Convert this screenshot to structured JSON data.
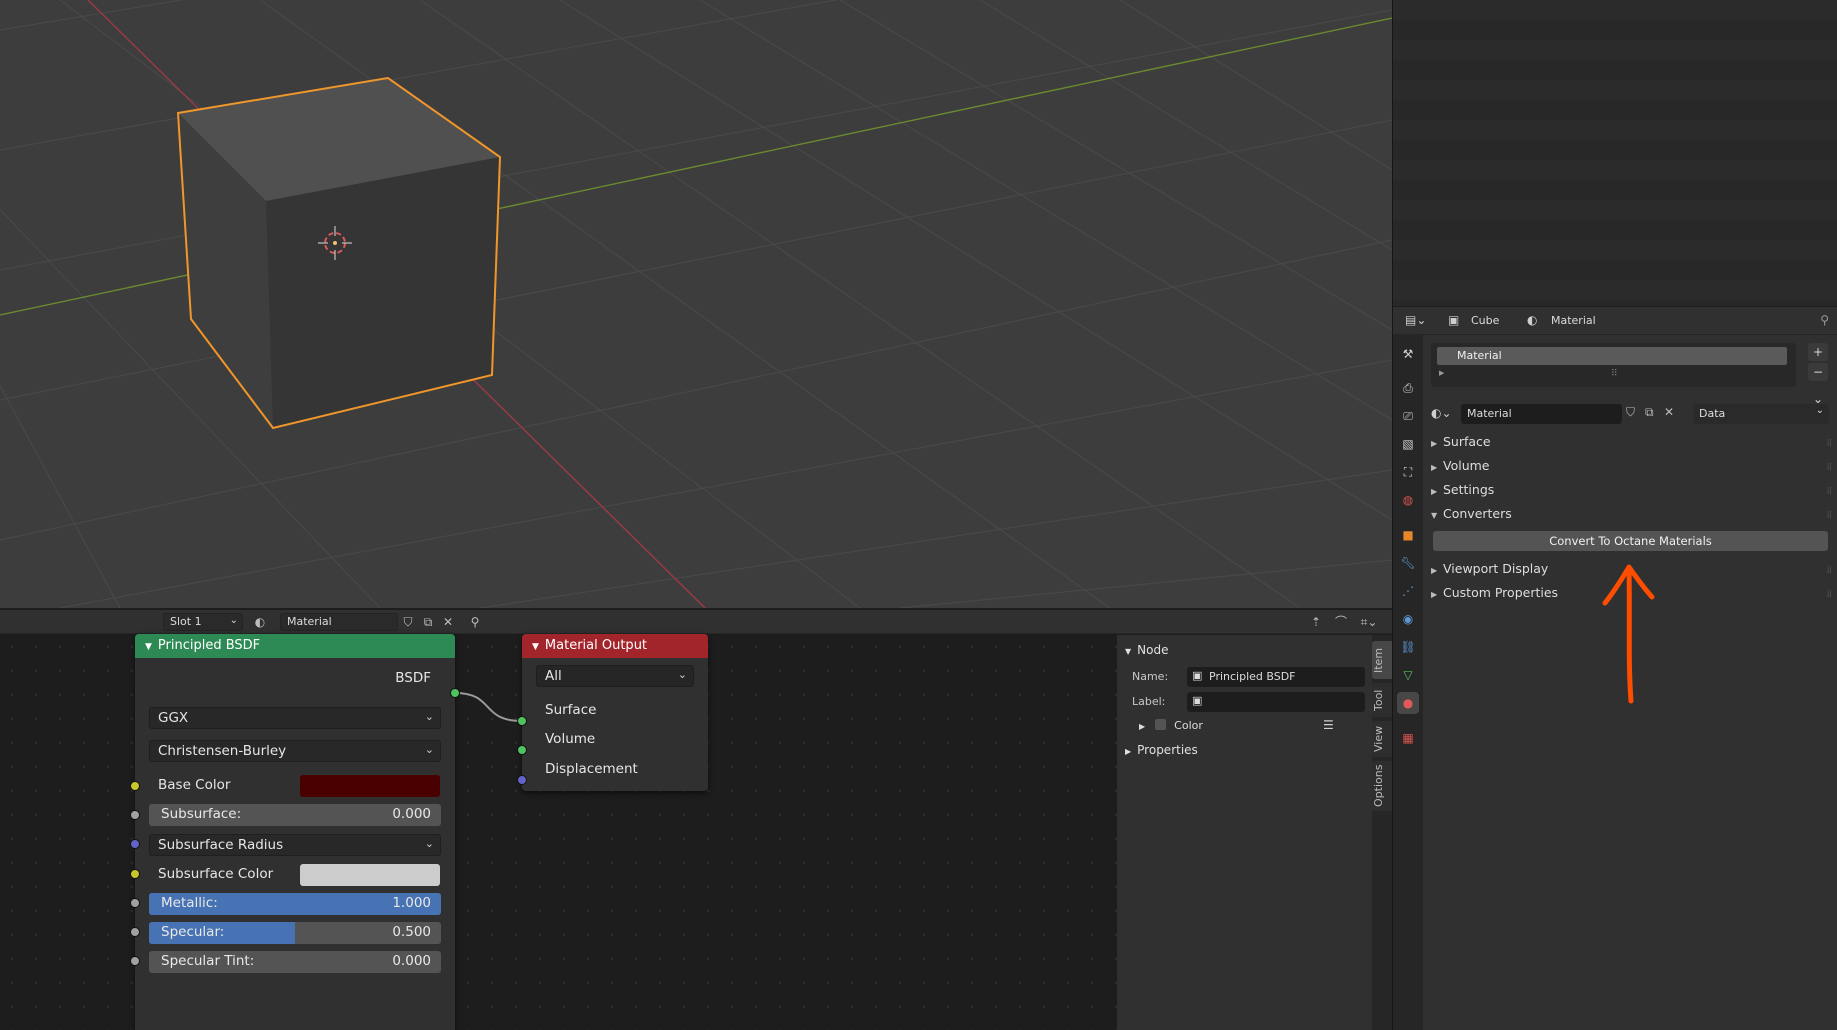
{
  "node_editor": {
    "header": {
      "slot": "Slot 1",
      "material": "Material"
    },
    "nodes": {
      "bsdf": {
        "title": "Principled BSDF",
        "output": "BSDF",
        "distribution": "GGX",
        "subsurface_method": "Christensen-Burley",
        "base_color_label": "Base Color",
        "base_color": "#4a0000",
        "subsurface_label": "Subsurface:",
        "subsurface_value": "0.000",
        "subsurface_radius": "Subsurface Radius",
        "subsurface_color_label": "Subsurface Color",
        "subsurface_color": "#cccccc",
        "metallic_label": "Metallic:",
        "metallic_value": "1.000",
        "metallic_fill": 1.0,
        "specular_label": "Specular:",
        "specular_value": "0.500",
        "specular_fill": 0.5,
        "specular_tint_label": "Specular Tint:",
        "specular_tint_value": "0.000"
      },
      "output": {
        "title": "Material Output",
        "target": "All",
        "surface": "Surface",
        "volume": "Volume",
        "displacement": "Displacement"
      }
    },
    "sidebar": {
      "section_node": "Node",
      "name_label": "Name:",
      "name_value": "Principled BSDF",
      "label_label": "Label:",
      "label_value": "",
      "color_label": "Color",
      "section_properties": "Properties",
      "tabs": [
        "Item",
        "Tool",
        "View",
        "Options"
      ]
    }
  },
  "properties": {
    "breadcrumb": {
      "object": "Cube",
      "material": "Material"
    },
    "slot_item": "Material",
    "material_name": "Material",
    "link_mode": "Data",
    "panels": {
      "surface": "Surface",
      "volume": "Volume",
      "settings": "Settings",
      "converters": "Converters",
      "convert_button": "Convert To Octane Materials",
      "viewport_display": "Viewport Display",
      "custom_properties": "Custom Properties"
    }
  },
  "colors": {
    "selection_outline": "#f0962a",
    "bsdf_header": "#2d8a54",
    "output_header": "#a3252c",
    "annotation_arrow": "#ff4d00",
    "slider_blue": "#4772b3"
  }
}
